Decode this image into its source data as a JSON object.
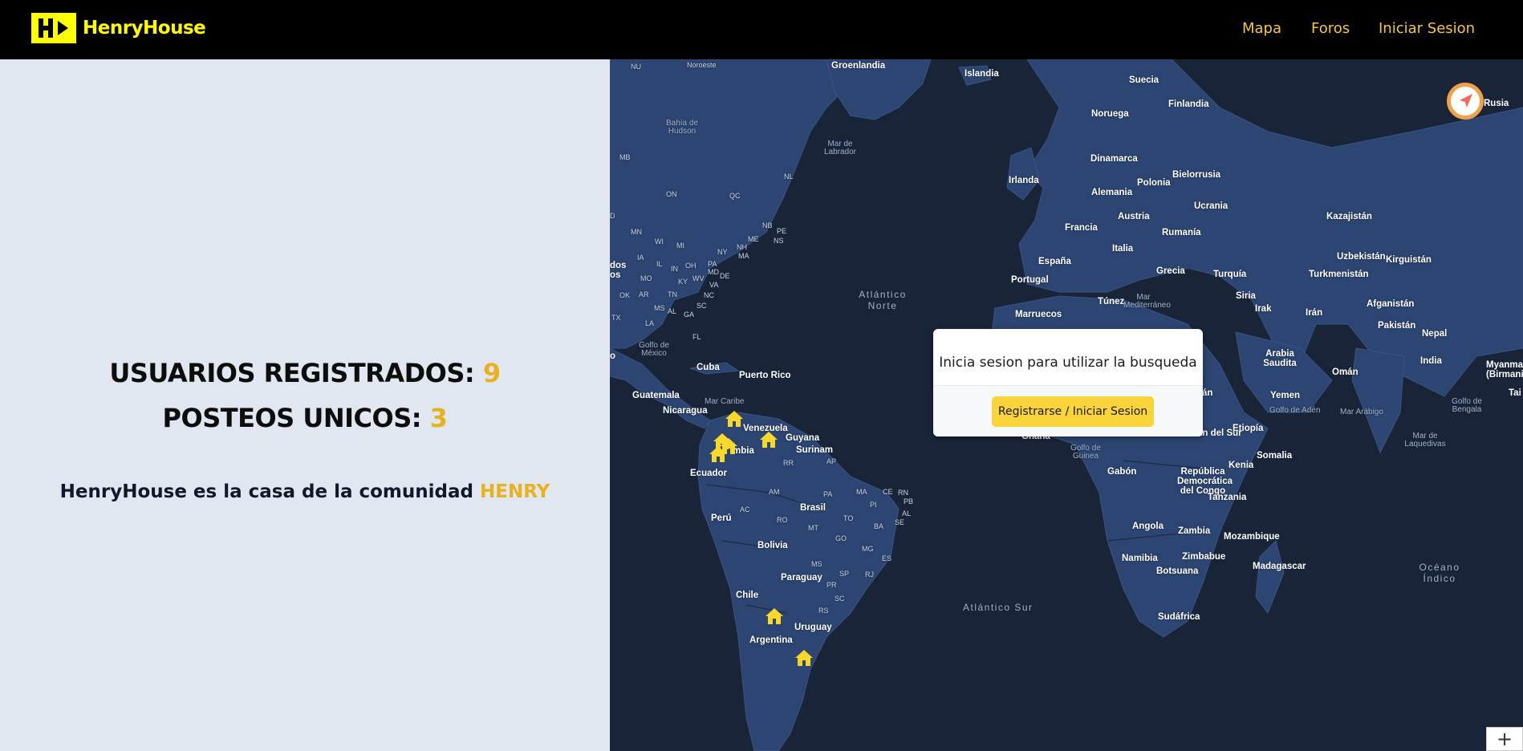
{
  "header": {
    "brand": "HenryHouse",
    "nav": [
      "Mapa",
      "Foros",
      "Iniciar Sesion"
    ]
  },
  "stats": {
    "users_label": "USUARIOS REGISTRADOS:",
    "users_value": "9",
    "posts_label": "POSTEOS UNICOS:",
    "posts_value": "3"
  },
  "tagline": {
    "text": "HenryHouse es la casa de la comunidad",
    "accent": "HENRY"
  },
  "map": {
    "login_prompt": "Inicia sesion para utilizar la busqueda",
    "login_button": "Registrarse / Iniciar Sesion",
    "zoom_in": "+",
    "labels": {
      "countries": [
        "Groenlandia",
        "Islandia",
        "Suecia",
        "Noruega",
        "Finlandia",
        "Rusia",
        "Dinamarca",
        "Irlanda",
        "Bielorrusia",
        "Alemania",
        "Polonia",
        "Ucrania",
        "Kazajistán",
        "Austria",
        "Francia",
        "Rumanía",
        "Italia",
        "Uzbekistán",
        "Kirguistán",
        "España",
        "Grecia",
        "Turquía",
        "Turkmenistán",
        "Portugal",
        "Siria",
        "Afganistán",
        "Túnez",
        "Irak",
        "Irán",
        "Marruecos",
        "Pakistán",
        "Nepal",
        "Arabia Saudita",
        "India",
        "Myanma (Birmani",
        "Omán",
        "Yemen",
        "Etiopía",
        "Somalia",
        "Kenia",
        "Gabón",
        "República Democrática del Congo",
        "Tanzania",
        "Angola",
        "Zambia",
        "Mozambique",
        "Zimbabue",
        "Namibia",
        "Botsuana",
        "Madagascar",
        "Sudáfrica",
        "Cuba",
        "Puerto Rico",
        "Guatemala",
        "Nicaragua",
        "Venezuela",
        "Guyana",
        "Surinam",
        "Ecuador",
        "Brasil",
        "Perú",
        "Bolivia",
        "Paraguay",
        "Chile",
        "Uruguay",
        "Argentina",
        "Tai"
      ],
      "partial": [
        "mbia",
        "dán",
        "dán del Sur",
        "Ghana"
      ],
      "regions": [
        "NU",
        "Noroeste",
        "MB",
        "ON",
        "QC",
        "NL",
        "NB",
        "PE",
        "NS",
        "MN",
        "WI",
        "MI",
        "ME",
        "NH",
        "NY",
        "MA",
        "IA",
        "IL",
        "IN",
        "OH",
        "PA",
        "MD",
        "DE",
        "MO",
        "KY",
        "WV",
        "VA",
        "OK",
        "AR",
        "TN",
        "NC",
        "SC",
        "MS",
        "AL",
        "GA",
        "TX",
        "LA",
        "FL",
        "RR",
        "AP",
        "AM",
        "PA",
        "MA",
        "CE",
        "RN",
        "PB",
        "AC",
        "RO",
        "PI",
        "AL",
        "SE",
        "TO",
        "BA",
        "MT",
        "GO",
        "MG",
        "ES",
        "MS",
        "SP",
        "RJ",
        "PR",
        "SC",
        "RS",
        "D",
        "dos",
        "os",
        "o"
      ],
      "seas": [
        "Bahía de Hudson",
        "Mar de Labrador",
        "Golfo de México",
        "Mar Caribe",
        "Mar Mediterráneo",
        "Golfo de Adén",
        "Mar Arábigo",
        "Golfo de Bengala",
        "Mar de Laquedivas",
        "Golfo de Guinea"
      ],
      "oceans": [
        "Atlántico Norte",
        "Atlántico Sur",
        "Océano Índico"
      ]
    },
    "colors": {
      "ocean": "#1a2438",
      "land": "#2c4572",
      "marker": "#f7d82b",
      "accent": "#e8b21e"
    },
    "markers": [
      "house-icon",
      "house-icon",
      "house-icon",
      "house-icon",
      "house-icon",
      "house-icon",
      "house-icon"
    ]
  }
}
